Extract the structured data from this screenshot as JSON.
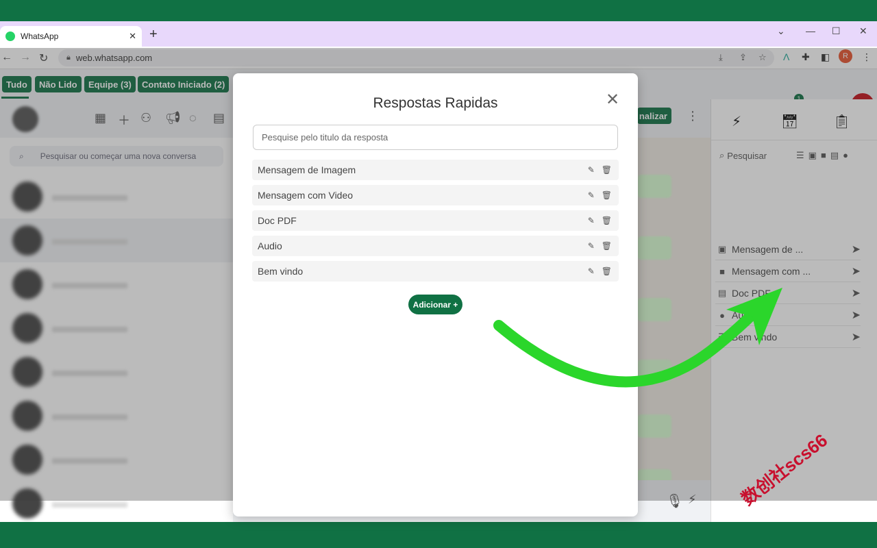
{
  "browser": {
    "tab_title": "WhatsApp",
    "tab_close": "✕",
    "new_tab": "+",
    "url": "web.whatsapp.com",
    "profile_initial": "R",
    "window_controls": [
      "⌄",
      "—",
      "☐",
      "✕"
    ]
  },
  "filters": [
    {
      "label": "Tudo"
    },
    {
      "label": "Não Lido"
    },
    {
      "label": "Equipe (3)"
    },
    {
      "label": "Contato Iniciado (2)"
    }
  ],
  "notification_count": "1",
  "sidebar": {
    "search_placeholder": "Pesquisar ou começar uma nova conversa"
  },
  "conversation": {
    "finalize_label": "nalizar"
  },
  "right_panel": {
    "search_label": "Pesquisar",
    "items": [
      {
        "icon": "image-icon",
        "glyph": "▣",
        "label": "Mensagem de ..."
      },
      {
        "icon": "video-icon",
        "glyph": "■",
        "label": "Mensagem com ..."
      },
      {
        "icon": "document-icon",
        "glyph": "▤",
        "label": "Doc PDF"
      },
      {
        "icon": "microphone-icon",
        "glyph": "●",
        "label": "Audio"
      },
      {
        "icon": "text-icon",
        "glyph": "☰",
        "label": "Bem vindo"
      }
    ]
  },
  "modal": {
    "title": "Respostas Rapidas",
    "close": "✕",
    "search_placeholder": "Pesquise pelo titulo da resposta",
    "items": [
      {
        "label": "Mensagem de Imagem"
      },
      {
        "label": "Mensagem com Video"
      },
      {
        "label": "Doc PDF"
      },
      {
        "label": "Audio"
      },
      {
        "label": "Bem vindo"
      }
    ],
    "add_button": "Adicionar +"
  },
  "watermark": "数创社scs66",
  "colors": {
    "brand_green": "#107144",
    "arrow_green": "#2bd62b"
  }
}
